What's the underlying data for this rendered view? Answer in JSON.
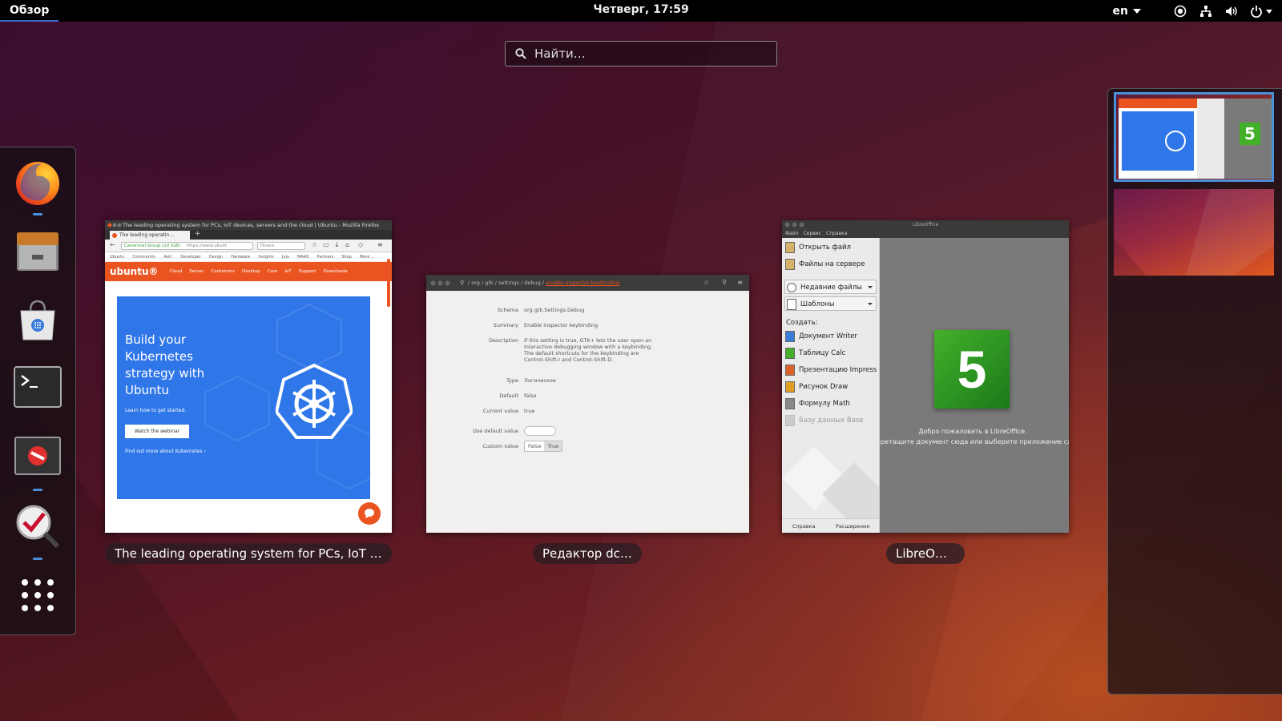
{
  "topbar": {
    "activities": "Обзор",
    "clock": "Четверг, 17:59",
    "language": "en",
    "icons": [
      "accessibility-icon",
      "network-icon",
      "volume-icon",
      "power-icon"
    ]
  },
  "search": {
    "placeholder": "Найти…"
  },
  "dock": {
    "items": [
      {
        "name": "firefox",
        "running": true
      },
      {
        "name": "files",
        "running": false
      },
      {
        "name": "software",
        "running": false
      },
      {
        "name": "terminal",
        "running": false
      },
      {
        "name": "dconf",
        "running": true
      },
      {
        "name": "libreoffice-checker",
        "running": true
      },
      {
        "name": "show-applications",
        "running": false
      }
    ]
  },
  "windows": {
    "firefox": {
      "label": "The leading operating system for PCs, IoT devi…",
      "title": "The leading operating system for PCs, IoT devices, servers and the cloud | Ubuntu - Mozilla Firefox",
      "tab": "The leading operatin…",
      "url_identity": "Canonical Group Ltd (GB)",
      "url": "https://www.ubunt",
      "search_placeholder": "Поиск",
      "menu": [
        "Ubuntu",
        "Community",
        "Ask!",
        "Developer",
        "Design",
        "Hardware",
        "Insights",
        "Juju",
        "MAAS",
        "Partners",
        "Shop",
        "More ⌄"
      ],
      "logo": "ubuntu®",
      "nav": [
        "Cloud",
        "Server",
        "Containers",
        "Desktop",
        "Core",
        "IoT",
        "Support",
        "Downloads"
      ],
      "hero_title": "Build your Kubernetes strategy with Ubuntu",
      "hero_learn": "Learn how to get started.",
      "hero_button": "Watch the webinar",
      "hero_more": "Find out more about Kubernetes ›"
    },
    "dconf": {
      "label": "Редактор dconf",
      "path": "/ org / gtk / settings / debug / ",
      "path_key": "enable-inspector-keybinding",
      "rows": [
        {
          "key": "Schema",
          "value": "org.gtk.Settings.Debug"
        },
        {
          "key": "Summary",
          "value": "Enable inspector keybinding"
        },
        {
          "key": "Description",
          "value": "If this setting is true, GTK+ lets the user open an interactive debugging window with a keybinding. The default shortcuts for the keybinding are Control-Shift-I and Control-Shift-D."
        },
        {
          "key": "Type",
          "value": "Логическое"
        },
        {
          "key": "Default",
          "value": "false"
        },
        {
          "key": "Current value",
          "value": "true"
        },
        {
          "key": "Use default value",
          "value": ""
        },
        {
          "key": "Custom value",
          "value": ""
        }
      ],
      "toggle_false": "False",
      "toggle_true": "True"
    },
    "libreoffice": {
      "label": "LibreOffice",
      "title": "LibreOffice",
      "menu": [
        "Файл",
        "Сервис",
        "Справка"
      ],
      "open_file": "Открыть файл",
      "remote_files": "Файлы на сервере",
      "recent_files": "Недавние файлы",
      "templates": "Шаблоны",
      "create_label": "Создать:",
      "create": [
        "Документ Writer",
        "Таблицу Calc",
        "Презентацию Impress",
        "Рисунок Draw",
        "Формулу Math",
        "Базу данных Base"
      ],
      "help": "Справка",
      "extensions": "Расширения",
      "logo_text": "5",
      "welcome": "Добро пожаловать в LibreOffice.",
      "welcome_hint": "Перетащите документ сюда или выберите приложение слева"
    }
  },
  "workspaces": [
    {
      "name": "workspace-1",
      "active": true,
      "logo_text": "5"
    },
    {
      "name": "workspace-2",
      "active": false
    }
  ],
  "colors": {
    "accent": "#4a90d9",
    "ubuntu_orange": "#e95420",
    "kubernetes_blue": "#2f76e8",
    "lo_green": "#43b02a"
  }
}
